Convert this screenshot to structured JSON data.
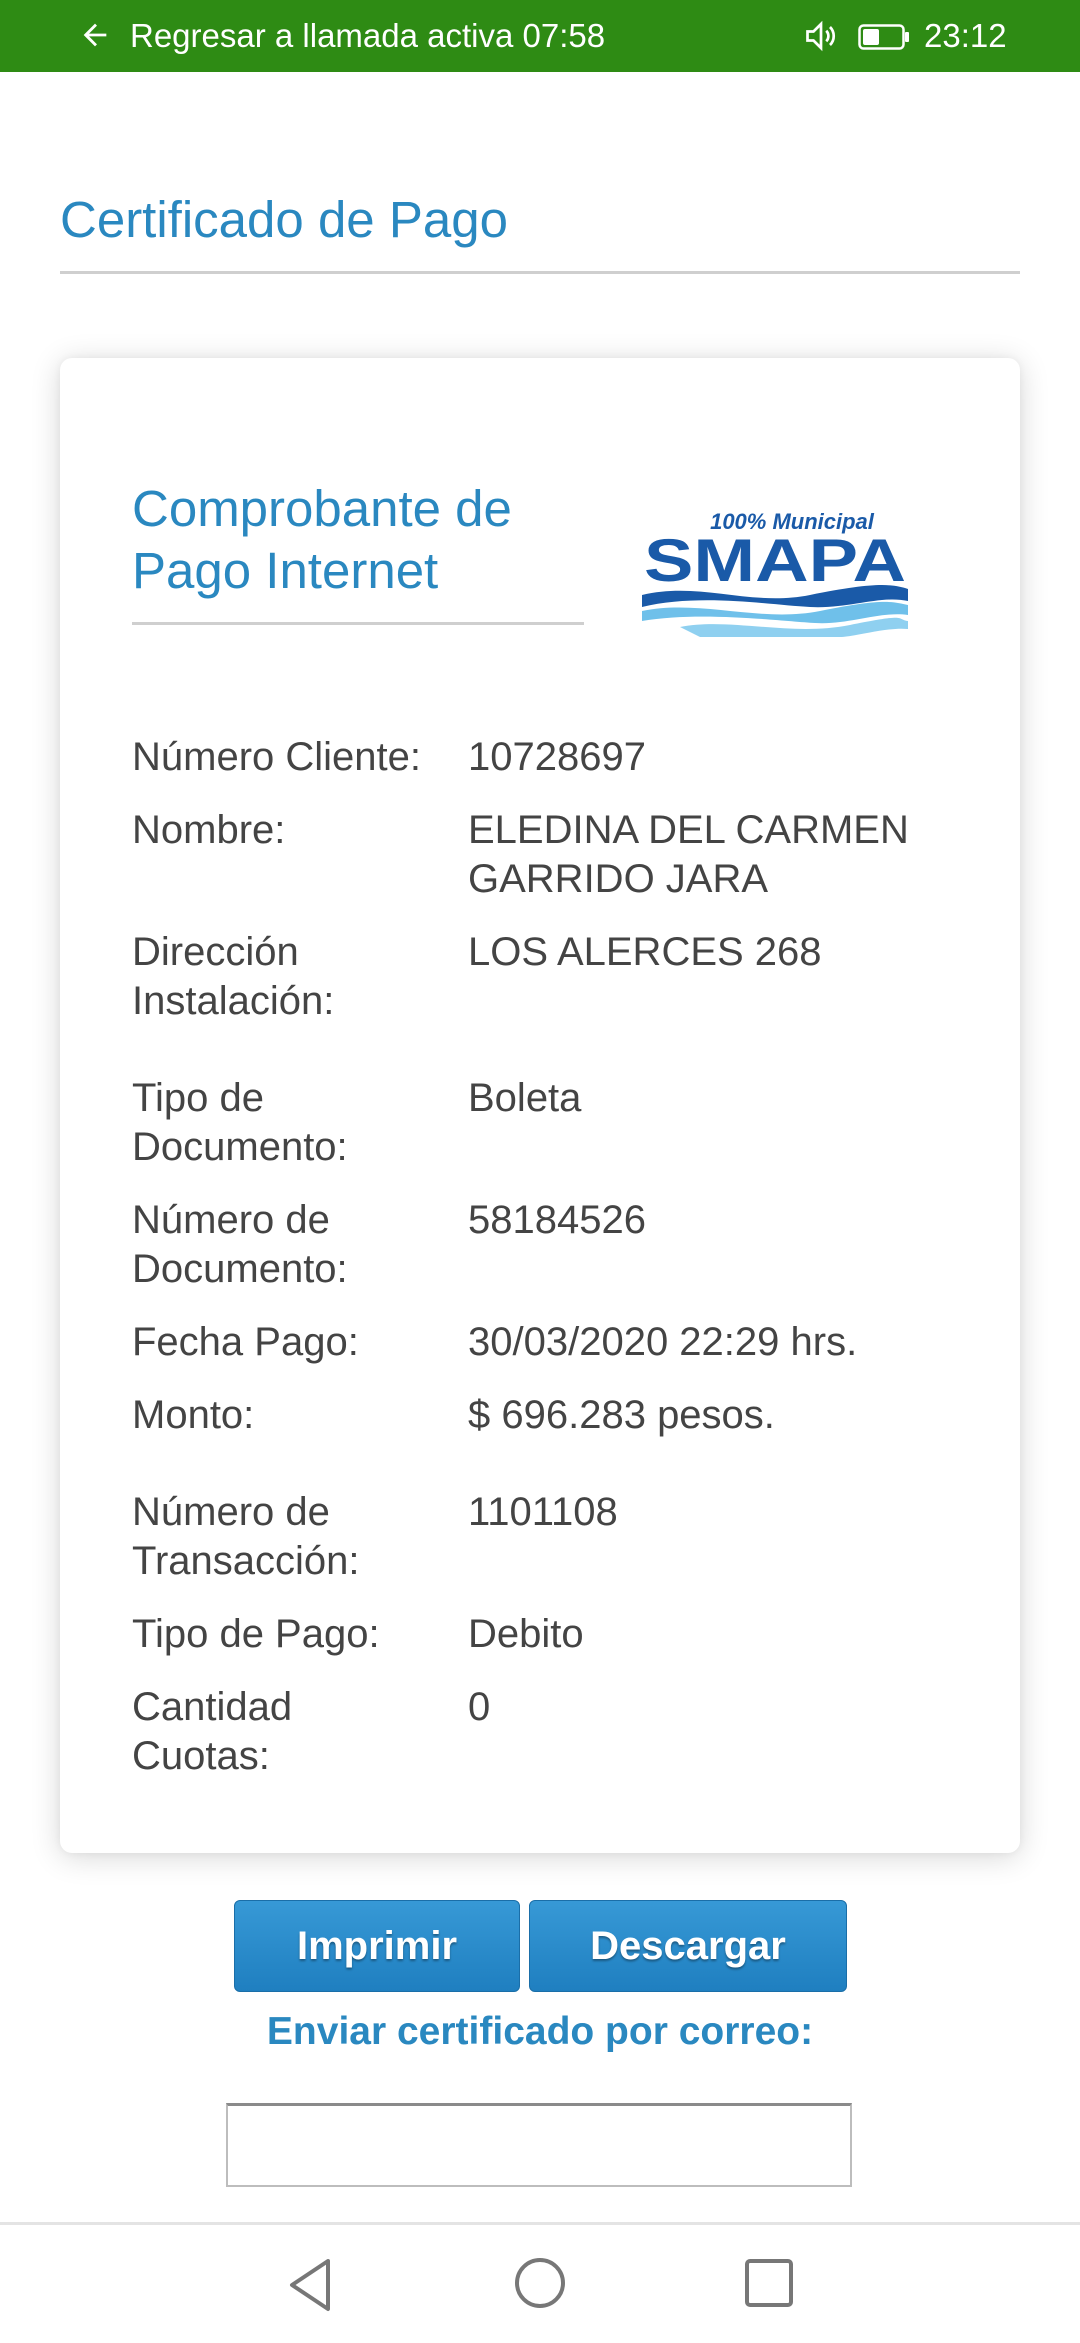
{
  "status_bar": {
    "call_text": "Regresar a llamada activa 07:58",
    "time": "23:12"
  },
  "page": {
    "title": "Certificado de Pago"
  },
  "card": {
    "title": "Comprobante de Pago Internet",
    "logo": {
      "tagline": "100% Municipal",
      "name": "SMAPA",
      "colors": {
        "primary": "#1a5aa8",
        "wave_light": "#6fc0ea"
      }
    },
    "fields": [
      {
        "label": "Número Cliente:",
        "value": "10728697"
      },
      {
        "label": "Nombre:",
        "value": "ELEDINA DEL CARMEN GARRIDO JARA"
      },
      {
        "label": "Dirección Instalación:",
        "value": "LOS ALERCES 268"
      },
      {
        "label": "Tipo de Documento:",
        "value": "Boleta"
      },
      {
        "label": "Número de Documento:",
        "value": "58184526"
      },
      {
        "label": "Fecha Pago:",
        "value": "30/03/2020 22:29 hrs."
      },
      {
        "label": "Monto:",
        "value": "$ 696.283 pesos."
      },
      {
        "label": "Número de Transacción:",
        "value": "1101108"
      },
      {
        "label": "Tipo de Pago:",
        "value": "Debito"
      },
      {
        "label": "Cantidad Cuotas:",
        "value": "0"
      }
    ]
  },
  "actions": {
    "print_label": "Imprimir",
    "download_label": "Descargar",
    "email_label": "Enviar certificado por correo:",
    "email_value": ""
  },
  "icons": {
    "status_back": "arrow-left-icon",
    "volume": "volume-icon",
    "battery": "battery-icon",
    "nav_back": "triangle-back-icon",
    "nav_home": "circle-home-icon",
    "nav_recent": "square-recents-icon"
  },
  "colors": {
    "status_bar": "#2e8b14",
    "accent": "#2a88c0",
    "button": "#2a8bcc"
  }
}
